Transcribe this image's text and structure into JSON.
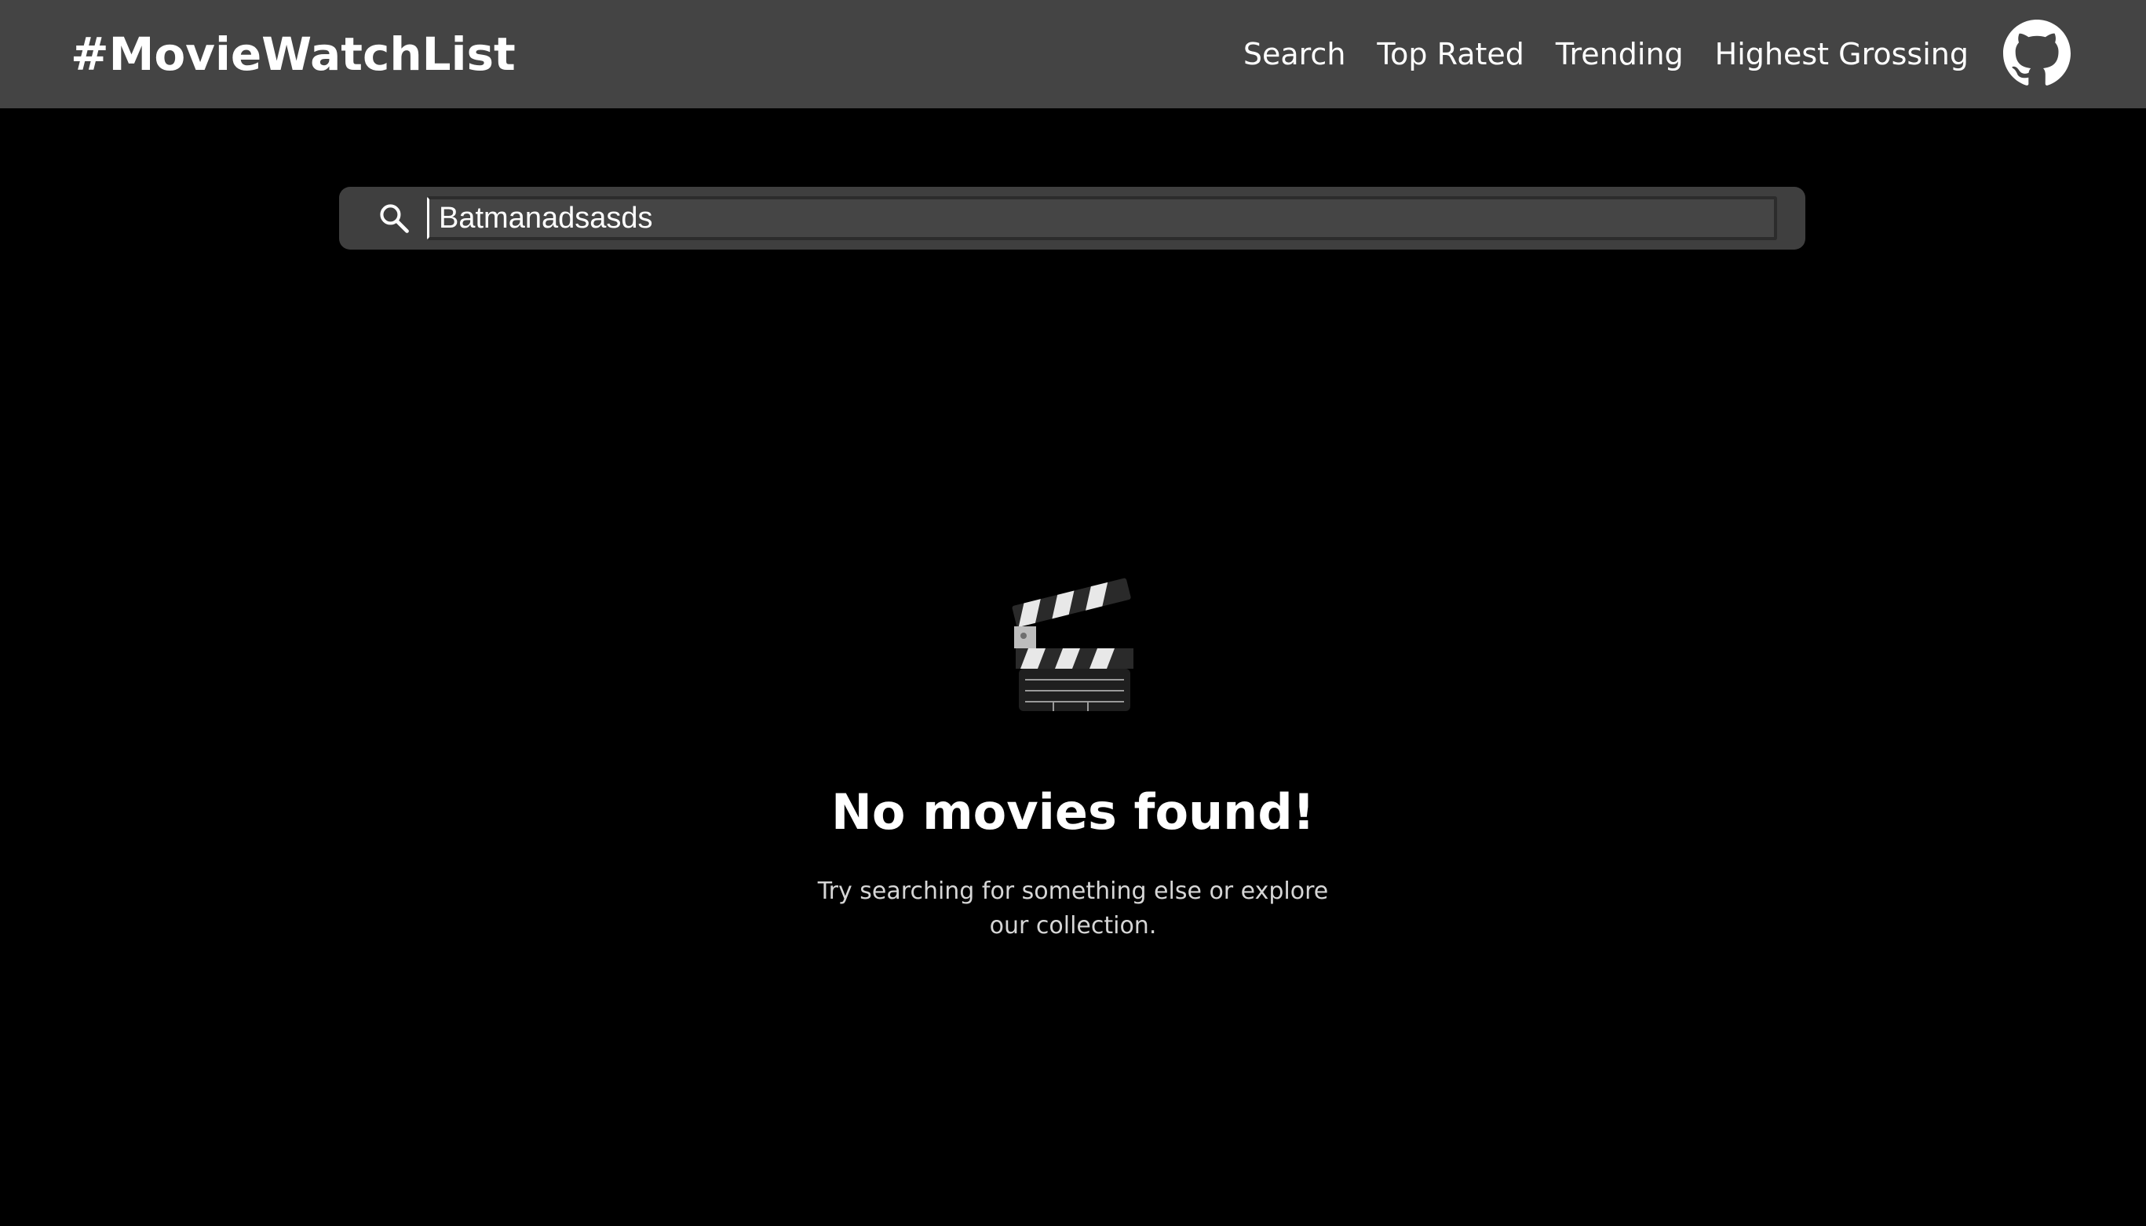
{
  "navbar": {
    "brand": "#MovieWatchList",
    "links": [
      {
        "label": "Search"
      },
      {
        "label": "Top Rated"
      },
      {
        "label": "Trending"
      },
      {
        "label": "Highest Grossing"
      }
    ],
    "github_icon": "github-icon"
  },
  "search": {
    "value": "Batmanadsasds",
    "icon": "search-icon"
  },
  "empty_state": {
    "icon": "clapperboard-icon",
    "title": "No movies found!",
    "subtitle": "Try searching for something else or explore our collection."
  },
  "colors": {
    "navbar_bg": "#444444",
    "page_bg": "#000000",
    "search_bg": "#3f3f3f"
  }
}
